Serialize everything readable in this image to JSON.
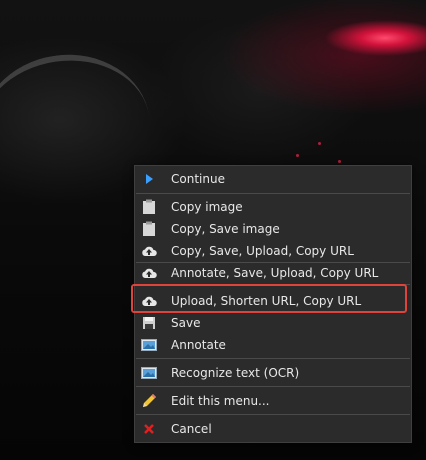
{
  "menu": {
    "items": [
      {
        "id": "continue",
        "label": "Continue",
        "icon": "play-arrow-icon"
      },
      {
        "id": "copy-image",
        "label": "Copy image",
        "icon": "clipboard-icon"
      },
      {
        "id": "copy-save-image",
        "label": "Copy, Save image",
        "icon": "clipboard-icon"
      },
      {
        "id": "copy-save-upload",
        "label": "Copy, Save, Upload, Copy URL",
        "icon": "cloud-upload-icon"
      },
      {
        "id": "annotate-save-upload",
        "label": "Annotate, Save, Upload, Copy URL",
        "icon": "cloud-upload-icon"
      },
      {
        "id": "upload-shorten",
        "label": "Upload, Shorten URL, Copy URL",
        "icon": "cloud-upload-icon"
      },
      {
        "id": "save",
        "label": "Save",
        "icon": "floppy-disk-icon"
      },
      {
        "id": "annotate",
        "label": "Annotate",
        "icon": "image-annotate-icon"
      },
      {
        "id": "ocr",
        "label": "Recognize text (OCR)",
        "icon": "image-ocr-icon"
      },
      {
        "id": "edit-menu",
        "label": "Edit this menu...",
        "icon": "pencil-icon"
      },
      {
        "id": "cancel",
        "label": "Cancel",
        "icon": "red-x-icon"
      }
    ]
  },
  "colors": {
    "menu_bg": "#2b2b2b",
    "menu_text": "#e8e8e8",
    "highlight_border": "#e0433c",
    "cancel_icon": "#e02020",
    "continue_icon": "#3aa0ff"
  }
}
